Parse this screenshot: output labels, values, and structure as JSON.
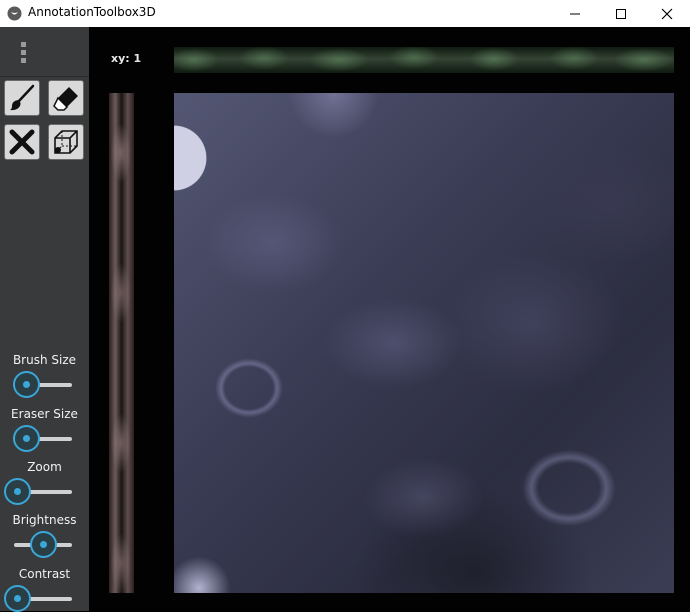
{
  "window": {
    "title": "AnnotationToolbox3D",
    "controls": [
      "minimize-icon",
      "maximize-icon",
      "close-icon"
    ]
  },
  "toolbar": {
    "tools": [
      {
        "name": "brush",
        "icon": "paintbrush-icon"
      },
      {
        "name": "eraser",
        "icon": "eraser-icon"
      },
      {
        "name": "clear",
        "icon": "close-x-icon"
      },
      {
        "name": "3d-view",
        "icon": "cube-wireframe-icon"
      }
    ]
  },
  "sliders": [
    {
      "label": "Brush Size",
      "value_fraction": 0.15
    },
    {
      "label": "Eraser Size",
      "value_fraction": 0.15
    },
    {
      "label": "Zoom",
      "value_fraction": 0.03
    },
    {
      "label": "Brightness",
      "value_fraction": 0.5
    },
    {
      "label": "Contrast",
      "value_fraction": 0.03
    }
  ],
  "viewer": {
    "xy_label": "xy: 1"
  },
  "colors": {
    "sidebar": "#393a3b",
    "accent": "#3aa7d8",
    "background": "#020202"
  }
}
